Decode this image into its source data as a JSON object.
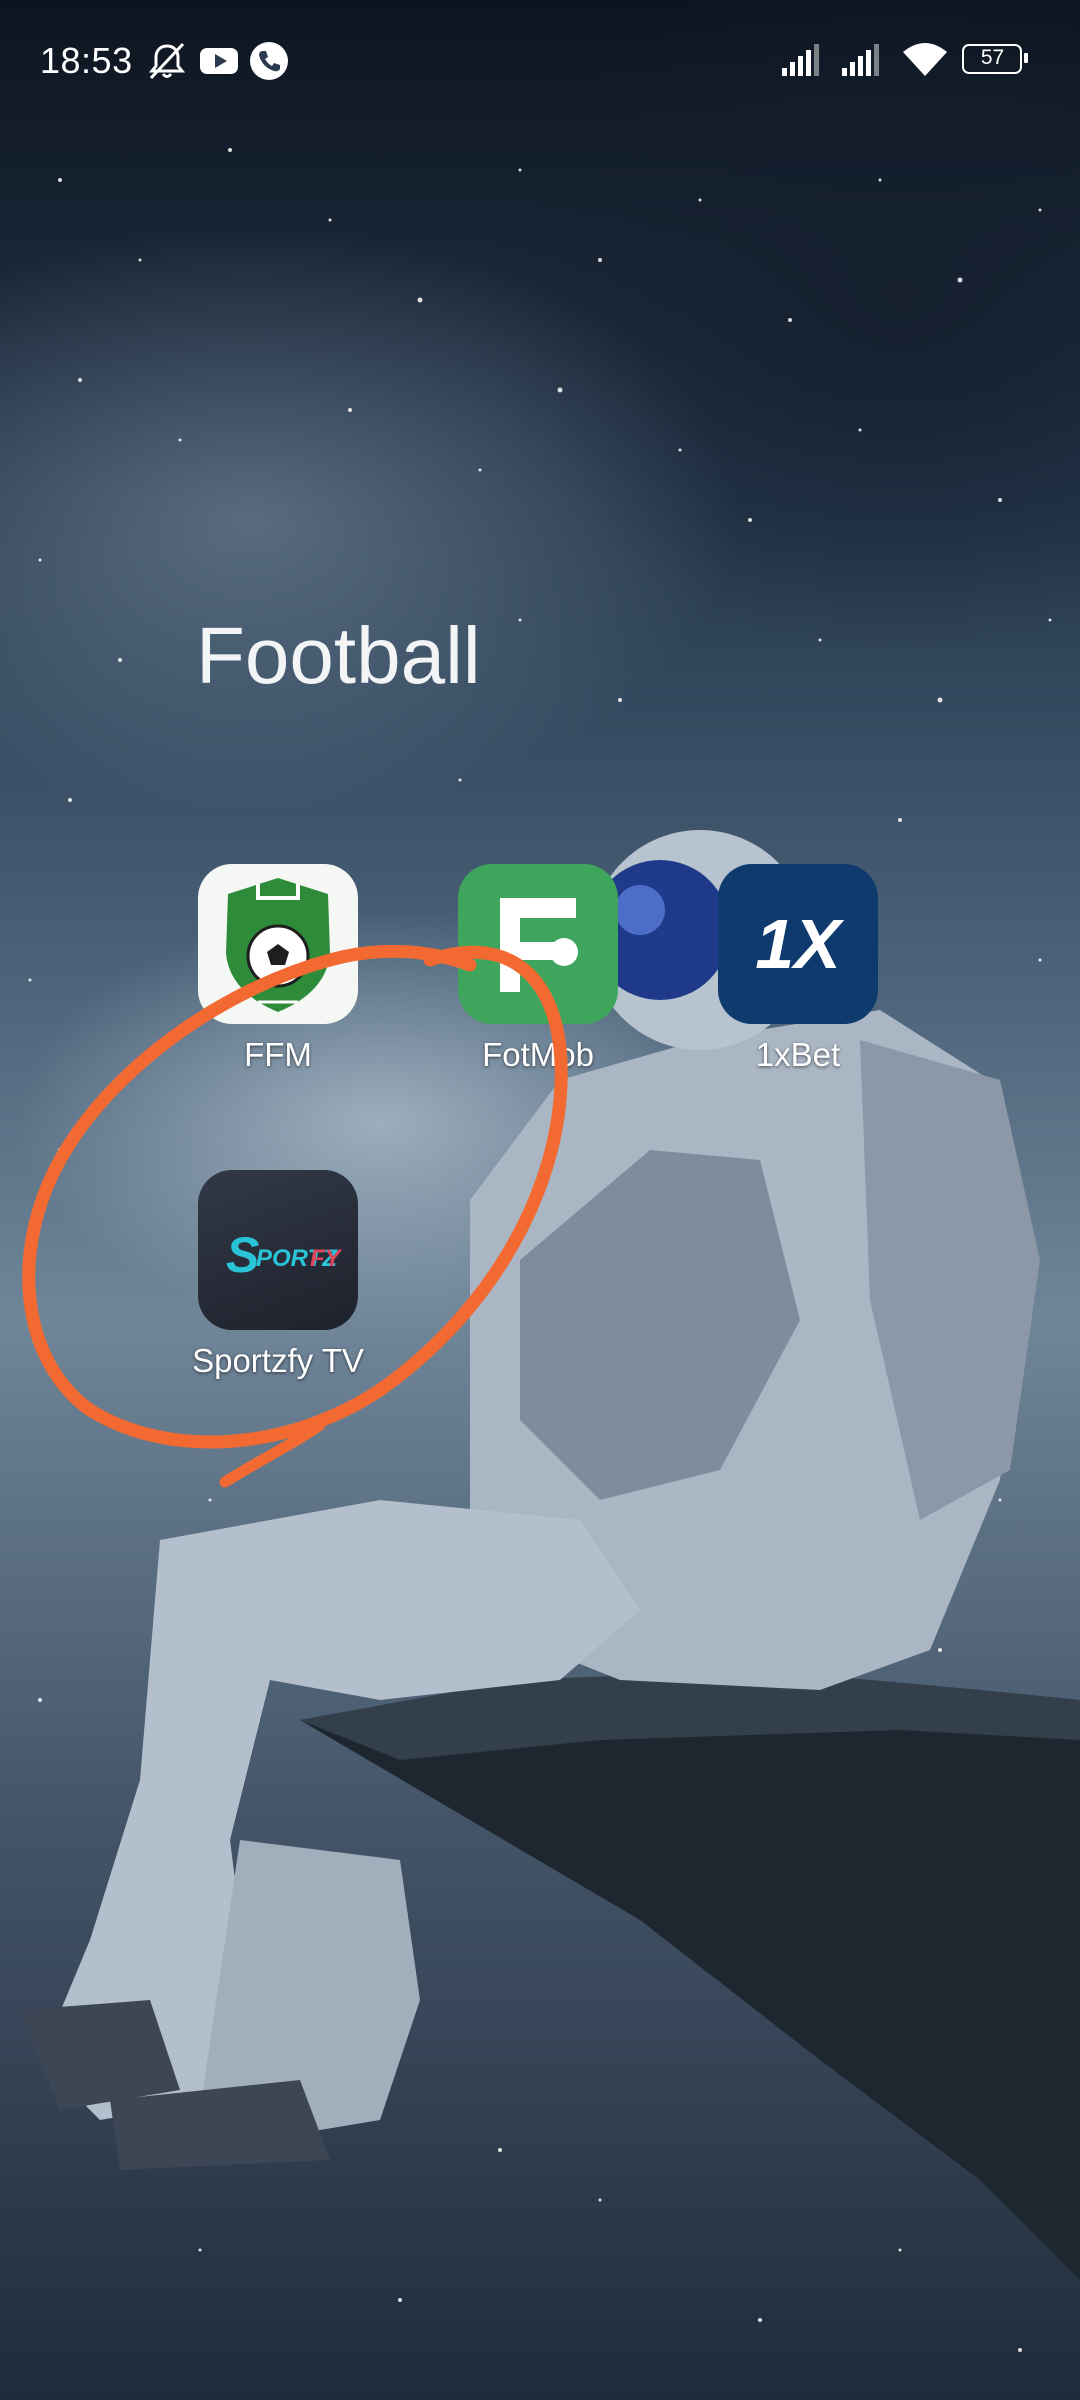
{
  "status_bar": {
    "time": "18:53",
    "battery_level": "57",
    "icons": [
      "notifications-muted-icon",
      "youtube-icon",
      "phone-call-icon",
      "signal-icon",
      "signal-icon",
      "wifi-icon",
      "battery-icon"
    ]
  },
  "folder": {
    "title": "Football",
    "apps": [
      {
        "label": "FFM",
        "icon": "ffm-soccer-shield-icon",
        "color": "#2e8b3a"
      },
      {
        "label": "FotMob",
        "icon": "fotmob-icon",
        "color": "#3fa55d"
      },
      {
        "label": "1xBet",
        "icon": "1xbet-icon",
        "color": "#0f3a6e"
      },
      {
        "label": "Sportzfy TV",
        "icon": "sportzfy-icon",
        "color": "#2a2f3a"
      }
    ]
  },
  "annotation": {
    "shape": "freehand-circle",
    "color": "#f26a32",
    "encircles": "Sportzfy TV"
  }
}
